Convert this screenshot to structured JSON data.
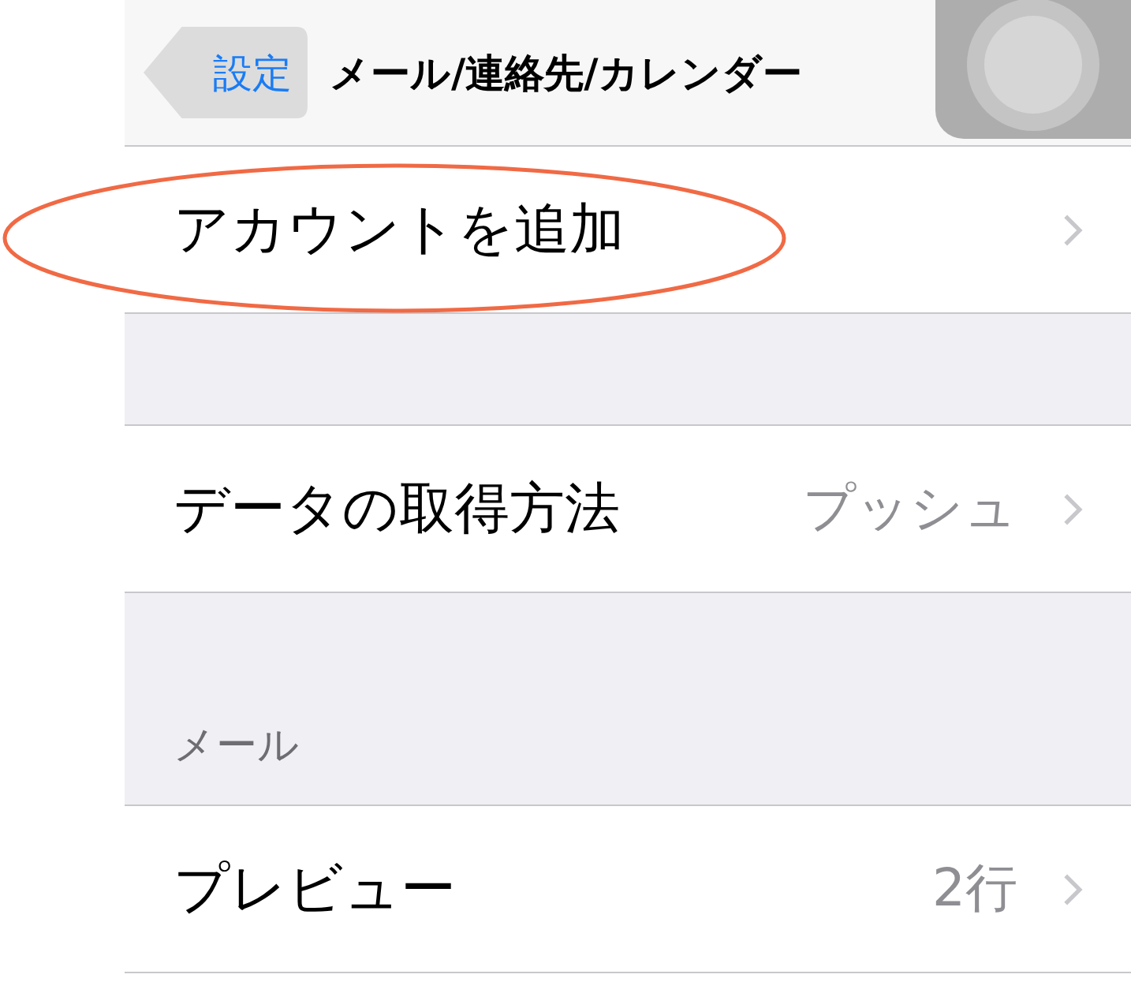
{
  "nav_bar": {
    "back": "設定",
    "title": "メール/連絡先/カレンダー"
  },
  "sections": [
    {
      "rows": [
        {
          "label": "アカウントを追加",
          "highlighted": true
        }
      ]
    },
    {
      "rows": [
        {
          "label": "データの取得方法",
          "value": "プッシュ",
          "highlighted": false
        }
      ]
    },
    {
      "header": "メール",
      "rows": [
        {
          "label": "プレビュー",
          "value": "2行",
          "highlighted": false
        }
      ]
    }
  ]
}
